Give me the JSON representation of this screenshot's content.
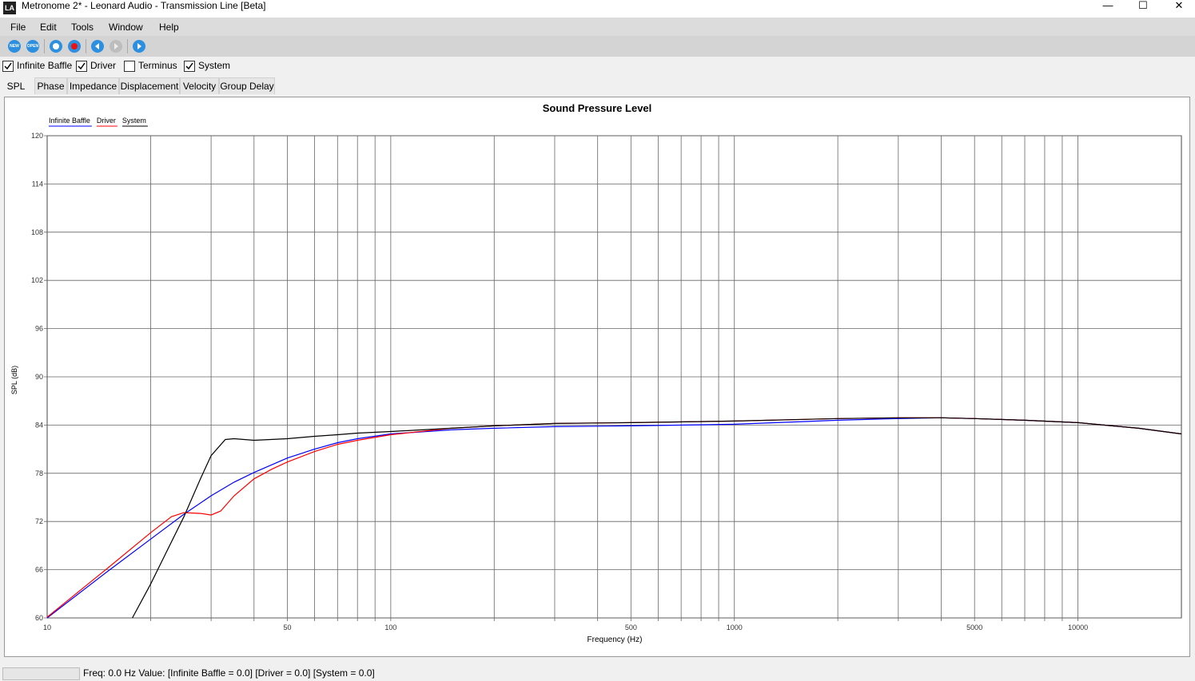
{
  "window": {
    "title": "Metronome 2* - Leonard Audio - Transmission Line [Beta]",
    "app_icon": "LA",
    "minimize_glyph": "—",
    "maximize_glyph": "☐",
    "close_glyph": "✕"
  },
  "menu": [
    "File",
    "Edit",
    "Tools",
    "Window",
    "Help"
  ],
  "toolbar": {
    "buttons": [
      {
        "icon": "new-icon",
        "label": "NEW"
      },
      {
        "icon": "open-icon",
        "label": "OPEN"
      },
      {
        "icon": "stop-icon",
        "label": ""
      },
      {
        "icon": "record-icon",
        "label": ""
      },
      {
        "icon": "step-back-icon",
        "label": ""
      },
      {
        "icon": "play-disabled-icon",
        "label": ""
      },
      {
        "icon": "play-icon",
        "label": ""
      }
    ]
  },
  "checkboxes": [
    {
      "label": "Infinite Baffle",
      "checked": true
    },
    {
      "label": "Driver",
      "checked": true
    },
    {
      "label": "Terminus",
      "checked": false
    },
    {
      "label": "System",
      "checked": true
    }
  ],
  "tabs": [
    {
      "label": "SPL",
      "active": true
    },
    {
      "label": "Phase",
      "active": false
    },
    {
      "label": "Impedance",
      "active": false
    },
    {
      "label": "Displacement",
      "active": false
    },
    {
      "label": "Velocity",
      "active": false
    },
    {
      "label": "Group Delay",
      "active": false
    }
  ],
  "status": {
    "text": "Freq: 0.0 Hz  Value: [Infinite Baffle = 0.0]  [Driver = 0.0]  [System = 0.0]"
  },
  "chart_data": {
    "type": "line",
    "title": "Sound Pressure Level",
    "xlabel": "Frequency (Hz)",
    "ylabel": "SPL (dB)",
    "x_scale": "log",
    "xlim": [
      10,
      20000
    ],
    "ylim": [
      60,
      120
    ],
    "x_tick_labels": [
      {
        "value": 10,
        "label": "10"
      },
      {
        "value": 50,
        "label": "50"
      },
      {
        "value": 100,
        "label": "100"
      },
      {
        "value": 500,
        "label": "500"
      },
      {
        "value": 1000,
        "label": "1000"
      },
      {
        "value": 5000,
        "label": "5000"
      },
      {
        "value": 10000,
        "label": "10000"
      }
    ],
    "y_ticks": [
      60,
      66,
      72,
      78,
      84,
      90,
      96,
      102,
      108,
      114,
      120
    ],
    "grid": true,
    "legend_position": "top-left",
    "series": [
      {
        "name": "Infinite Baffle",
        "color": "#0000ff",
        "x": [
          10,
          15,
          20,
          25,
          30,
          35,
          40,
          50,
          60,
          70,
          80,
          100,
          150,
          200,
          300,
          500,
          1000,
          2000,
          3000,
          4000,
          5000,
          7000,
          10000,
          15000,
          20000
        ],
        "y": [
          60.0,
          65.8,
          69.8,
          72.9,
          75.2,
          76.9,
          78.1,
          79.9,
          81.0,
          81.8,
          82.3,
          82.9,
          83.4,
          83.6,
          83.8,
          83.9,
          84.1,
          84.6,
          84.8,
          84.9,
          84.8,
          84.6,
          84.3,
          83.6,
          82.9
        ]
      },
      {
        "name": "Driver",
        "color": "#ff0000",
        "x": [
          10,
          15,
          20,
          23,
          25,
          28,
          30,
          32,
          35,
          40,
          45,
          50,
          60,
          70,
          80,
          100,
          150,
          200,
          300,
          500,
          1000,
          2000,
          3000,
          4000,
          5000,
          7000,
          10000,
          15000,
          20000
        ],
        "y": [
          60.1,
          66.2,
          70.6,
          72.6,
          73.1,
          73.0,
          72.8,
          73.3,
          75.2,
          77.3,
          78.5,
          79.4,
          80.7,
          81.6,
          82.1,
          82.8,
          83.6,
          83.9,
          84.2,
          84.3,
          84.5,
          84.8,
          84.9,
          84.9,
          84.8,
          84.6,
          84.3,
          83.6,
          82.9
        ]
      },
      {
        "name": "System",
        "color": "#000000",
        "x": [
          17.7,
          20,
          22,
          25,
          28,
          30,
          33,
          35,
          40,
          50,
          60,
          70,
          80,
          100,
          150,
          200,
          300,
          500,
          1000,
          2000,
          3000,
          4000,
          5000,
          7000,
          10000,
          15000,
          20000
        ],
        "y": [
          60.0,
          64.2,
          67.8,
          72.6,
          77.4,
          80.2,
          82.2,
          82.3,
          82.1,
          82.3,
          82.6,
          82.8,
          83.0,
          83.2,
          83.6,
          83.9,
          84.2,
          84.3,
          84.5,
          84.8,
          84.9,
          84.9,
          84.8,
          84.6,
          84.3,
          83.6,
          82.9
        ]
      }
    ]
  }
}
